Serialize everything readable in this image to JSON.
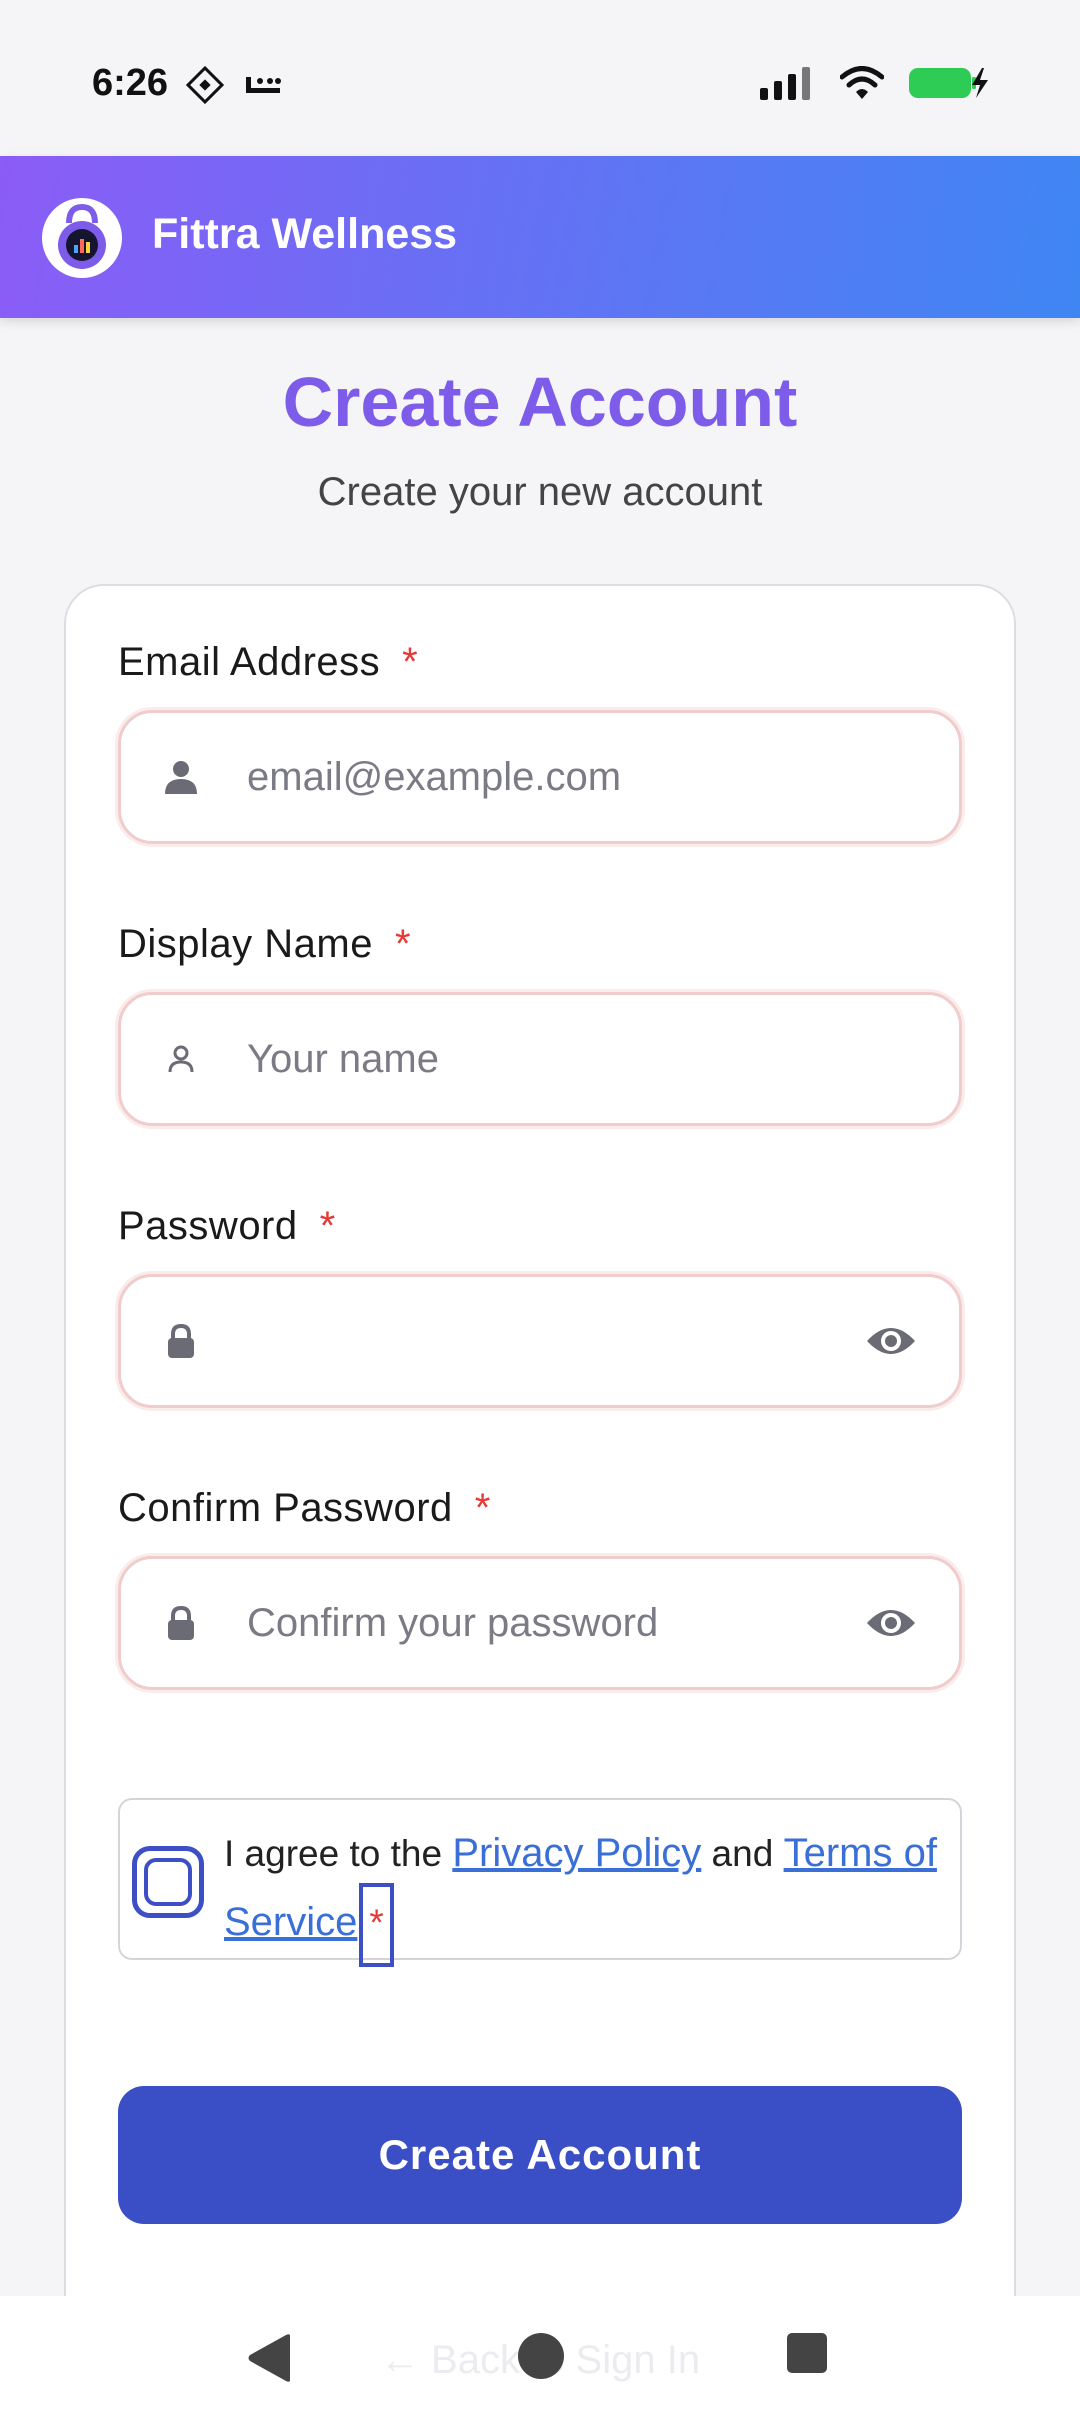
{
  "status_bar": {
    "time": "6:26"
  },
  "header": {
    "app_name": "Fittra Wellness"
  },
  "page": {
    "title": "Create Account",
    "subtitle": "Create your new account"
  },
  "form": {
    "email": {
      "label": "Email Address",
      "required_mark": "*",
      "placeholder": "email@example.com",
      "value": ""
    },
    "display_name": {
      "label": "Display Name",
      "required_mark": "*",
      "placeholder": "Your name",
      "value": ""
    },
    "password": {
      "label": "Password",
      "required_mark": "*",
      "placeholder": "",
      "value": ""
    },
    "confirm_password": {
      "label": "Confirm Password",
      "required_mark": "*",
      "placeholder": "Confirm your password",
      "value": ""
    },
    "terms": {
      "prefix": "I agree to the ",
      "privacy_link": "Privacy Policy",
      "middle": " and ",
      "terms_link": "Terms of Service",
      "required_mark": "*",
      "checked": false
    },
    "submit_label": "Create Account"
  },
  "footer": {
    "back_link": "← Back to Sign In"
  },
  "colors": {
    "accent": "#7c5ce8",
    "primary_button": "#3a4fc6",
    "link": "#3a6fd8",
    "required": "#e53935"
  }
}
